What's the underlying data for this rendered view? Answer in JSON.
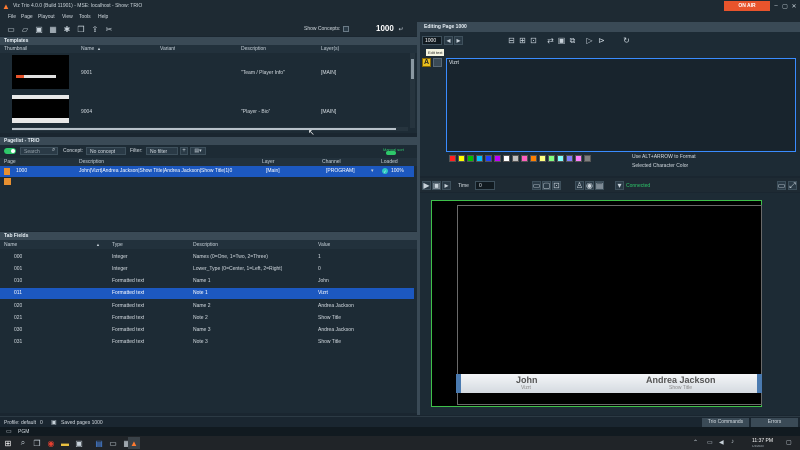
{
  "titlebar": {
    "title": "Viz Trio 4.0.0 (Build 11901) - MSE: localhost - Show: TRIO",
    "on_air": "ON AIR",
    "min": "–",
    "max": "▢",
    "close": "✕"
  },
  "menu": [
    "File",
    "Page",
    "Playout",
    "View",
    "Tools",
    "Help"
  ],
  "toolbar": {
    "show_concepts_label": "Show Concepts:",
    "page_number": "1000"
  },
  "templates": {
    "header": "Templates",
    "columns": [
      "Thumbnail",
      "Name",
      "Variant",
      "Description",
      "Layer(s)"
    ],
    "rows": [
      {
        "name": "9001",
        "variant": "",
        "description": "\"Team / Player Info\"",
        "layers": "[MAIN]"
      },
      {
        "name": "9004",
        "variant": "",
        "description": "\"Player - Bio\"",
        "layers": "[MAIN]"
      }
    ]
  },
  "pagelist": {
    "header": "Pagelist - TRIO",
    "search_placeholder": "Search",
    "concept_label": "Concept:",
    "concept_value": "No concept",
    "filter_label": "Filter:",
    "filter_value": "No filter",
    "sort_label": "Manual sort",
    "columns": [
      "Page",
      "Description",
      "Layer",
      "Channel",
      "Loaded"
    ],
    "rows": [
      {
        "page": "1000",
        "description": "John|Vizrt|Andrea Jackson|Show Title|Andrea Jackson|Show Title|1|0",
        "layer": "[Main]",
        "channel": "[PROGRAM]",
        "loaded": "100%"
      }
    ]
  },
  "tabfields": {
    "header": "Tab Fields",
    "columns": [
      "Name",
      "Type",
      "Description",
      "Value"
    ],
    "rows": [
      {
        "name": "000",
        "type": "Integer",
        "description": "Names (0=One, 1=Two, 2=Three)",
        "value": "1"
      },
      {
        "name": "001",
        "type": "Integer",
        "description": "Lower_Type (0=Center, 1=Left, 2=Right)",
        "value": "0"
      },
      {
        "name": "010",
        "type": "Formatted text",
        "description": "Name 1",
        "value": "John"
      },
      {
        "name": "011",
        "type": "Formatted text",
        "description": "Note 1",
        "value": "Vizrt"
      },
      {
        "name": "020",
        "type": "Formatted text",
        "description": "Name 2",
        "value": "Andrea Jackson"
      },
      {
        "name": "021",
        "type": "Formatted text",
        "description": "Note 2",
        "value": "Show Title"
      },
      {
        "name": "030",
        "type": "Formatted text",
        "description": "Name 3",
        "value": "Andrea Jackson"
      },
      {
        "name": "031",
        "type": "Formatted text",
        "description": "Note 3",
        "value": "Show Title"
      }
    ]
  },
  "editor": {
    "header": "Editing Page 1000",
    "page_number": "1000",
    "tooltip": "Edit text",
    "text_value": "Vizrt",
    "hint_line1": "Use ALT+ARROW to Format",
    "hint_line2": "Selected Character Color",
    "palette": [
      "#ff2020",
      "#ffff00",
      "#00c000",
      "#00c0ff",
      "#2040ff",
      "#c000ff",
      "#ffffff",
      "#c0c0c0",
      "#ff60c0",
      "#ff8000",
      "#ffff80",
      "#80ff80",
      "#80ffff",
      "#8080ff",
      "#ff80ff",
      "#808080"
    ]
  },
  "preview": {
    "time_label": "Time",
    "time_value": "0",
    "status": "Connected",
    "lower_third": {
      "name1": "John",
      "note1": "Vizrt",
      "name2": "Andrea Jackson",
      "note2": "Show Title"
    }
  },
  "statusbar": {
    "profile": "Profile: default",
    "counter": "0",
    "saved": "Saved pages 1000",
    "trio_commands": "Trio Commands",
    "errors": "Errors"
  },
  "taskbar": {
    "pgm": "PGM",
    "time": "11:37 PM",
    "date": "1/4/2023"
  }
}
